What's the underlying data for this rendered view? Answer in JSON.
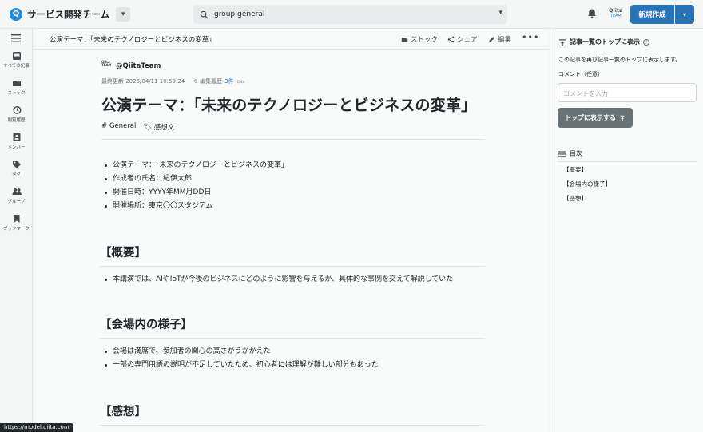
{
  "header": {
    "team_logo": "Q",
    "team_name": "サービス開発チーム",
    "team_toggle_icon": "chevron-down-icon",
    "search_value": "group:general",
    "team_badge_top": "Qiita",
    "team_badge_bottom": "TEAM",
    "new_button": "新規作成"
  },
  "leftnav": {
    "items": [
      {
        "label": "すべての記事",
        "icon": "inbox-icon"
      },
      {
        "label": "ストック",
        "icon": "folder-icon"
      },
      {
        "label": "閲覧履歴",
        "icon": "history-icon"
      },
      {
        "label": "メンバー",
        "icon": "member-icon"
      },
      {
        "label": "タグ",
        "icon": "tag-icon"
      },
      {
        "label": "グループ",
        "icon": "group-icon"
      },
      {
        "label": "ブックマーク",
        "icon": "bookmark-icon"
      }
    ]
  },
  "subbar": {
    "breadcrumb": "公演テーマ：「未来のテクノロジーとビジネスの変革」",
    "stock": "ストック",
    "share": "シェア",
    "edit": "編集",
    "more": "•••"
  },
  "article": {
    "author_avatar_top": "Qiita",
    "author_avatar_bottom": "TEAM",
    "author": "@QiitaTeam",
    "updated": "最終更新 2025/04/11 10:59:24",
    "history_label": "編集履歴",
    "history_count": "3件",
    "title": "公演テーマ：「未来のテクノロジーとビジネスの変革」",
    "tags": [
      "General",
      "感想文"
    ],
    "info": [
      "公演テーマ：「未来のテクノロジーとビジネスの変革」",
      "作成者の氏名：紀伊太郎",
      "開催日時：YYYY年MM月DD日",
      "開催場所：東京〇〇スタジアム"
    ],
    "sections": [
      {
        "heading": "【概要】",
        "items": [
          "本講演では、AIやIoTが今後のビジネスにどのように影響を与えるか、具体的な事例を交えて解説していた"
        ]
      },
      {
        "heading": "【会場内の様子】",
        "items": [
          "会場は満席で、参加者の関心の高さがうかがえた",
          "一部の専門用語の説明が不足していたため、初心者には理解が難しい部分もあった"
        ]
      },
      {
        "heading": "【感想】",
        "items": []
      }
    ]
  },
  "right": {
    "heading": "記事一覧のトップに表示",
    "help": "?",
    "description": "この記事を再び記事一覧のトップに表示します。",
    "comment_label": "コメント（任意）",
    "comment_placeholder": "コメントを入力",
    "pin_button": "トップに表示する",
    "toc_heading": "目次",
    "toc": [
      "【概要】",
      "【会場内の様子】",
      "【感想】"
    ]
  },
  "status_url": "https://model.qiita.com"
}
